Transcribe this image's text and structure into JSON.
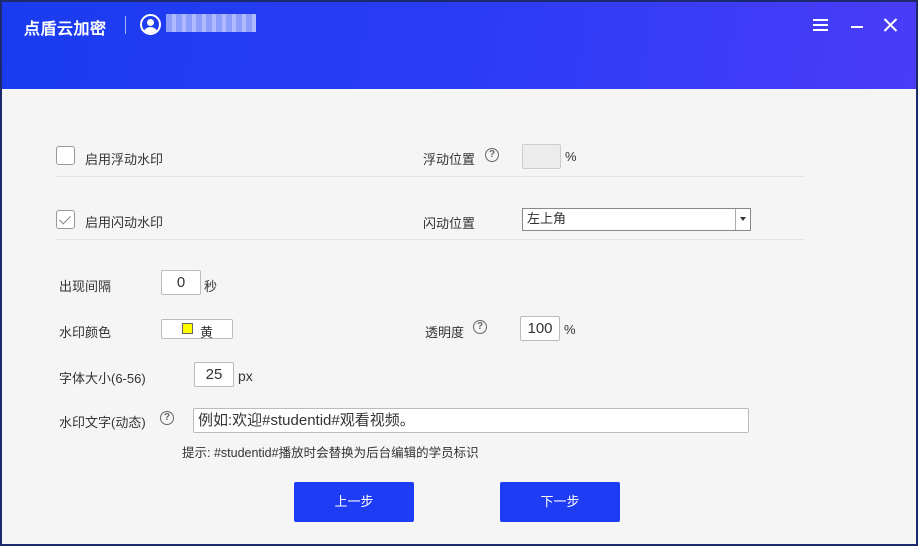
{
  "app": {
    "title": "点盾云加密"
  },
  "window_controls": {
    "menu": "menu-icon",
    "minimize": "minimize-icon",
    "close": "close-icon"
  },
  "colors": {
    "titlebar_start": "#1a3cf0",
    "titlebar_end": "#4a3cf8",
    "primary_button": "#1f3cf5",
    "watermark_color_swatch": "#ffff00"
  },
  "floating": {
    "enable_label": "启用浮动水印",
    "enabled": false,
    "position_label": "浮动位置",
    "position_value": "",
    "position_unit": "%"
  },
  "flash": {
    "enable_label": "启用闪动水印",
    "enabled": true,
    "position_label": "闪动位置",
    "position_value": "左上角"
  },
  "interval": {
    "label": "出现间隔",
    "value": "0",
    "unit": "秒"
  },
  "color": {
    "label": "水印颜色",
    "value": "黄"
  },
  "opacity": {
    "label": "透明度",
    "value": "100",
    "unit": "%"
  },
  "font_size": {
    "label": "字体大小(6-56)",
    "value": "25",
    "unit": "px"
  },
  "text": {
    "label": "水印文字(动态)",
    "value": "例如:欢迎#studentid#观看视频。",
    "hint": "提示: #studentid#播放时会替换为后台编辑的学员标识"
  },
  "buttons": {
    "prev": "上一步",
    "next": "下一步"
  },
  "help_glyph": "?"
}
